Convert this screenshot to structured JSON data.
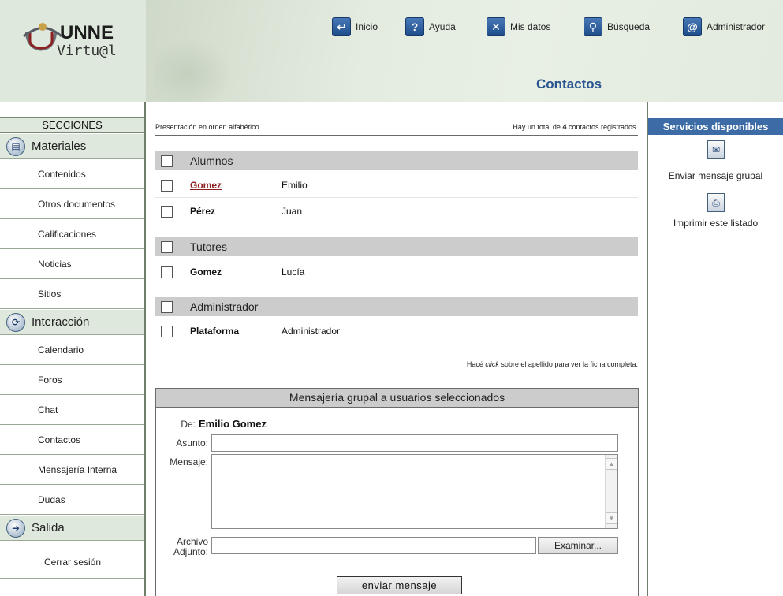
{
  "header": {
    "logo_line1": "UNNE",
    "logo_line2": "Virtu@l",
    "page_heading": "Contactos",
    "nav": [
      {
        "label": "Inicio",
        "icon": "home-icon",
        "glyph": "↩"
      },
      {
        "label": "Ayuda",
        "icon": "help-icon",
        "glyph": "?"
      },
      {
        "label": "Mis datos",
        "icon": "profile-icon",
        "glyph": "✕"
      },
      {
        "label": "Búsqueda",
        "icon": "search-icon",
        "glyph": "⚲"
      },
      {
        "label": "Administrador",
        "icon": "at-icon",
        "glyph": "@"
      }
    ]
  },
  "sidebar": {
    "title": "SECCIONES",
    "sections": [
      {
        "label": "Materiales",
        "icon": "materials-icon",
        "glyph": "▤",
        "items": [
          "Contenidos",
          "Otros documentos",
          "Calificaciones",
          "Noticias",
          "Sitios"
        ]
      },
      {
        "label": "Interacción",
        "icon": "interaction-icon",
        "glyph": "⟳",
        "items": [
          "Calendario",
          "Foros",
          "Chat",
          "Contactos",
          "Mensajería Interna",
          "Dudas"
        ]
      },
      {
        "label": "Salida",
        "icon": "exit-icon",
        "glyph": "➜",
        "items": [
          "Cerrar sesión"
        ]
      }
    ]
  },
  "main": {
    "info_left": "Presentación en orden alfabético.",
    "info_right_prefix": "Hay un total de ",
    "info_right_count": "4",
    "info_right_suffix": " contactos registrados.",
    "groups": [
      {
        "title": "Alumnos",
        "rows": [
          {
            "surname": "Gomez",
            "name": "Emilio",
            "link": true
          },
          {
            "surname": "Pérez",
            "name": "Juan",
            "link": false
          }
        ]
      },
      {
        "title": "Tutores",
        "rows": [
          {
            "surname": "Gomez",
            "name": "Lucía",
            "link": false
          }
        ]
      },
      {
        "title": "Administrador",
        "rows": [
          {
            "surname": "Plataforma",
            "name": "Administrador",
            "link": false
          }
        ]
      }
    ],
    "hint_prefix": "Hacé ",
    "hint_em": "click",
    "hint_suffix": " sobre el apellido para ver la ficha completa."
  },
  "message_panel": {
    "title": "Mensajería grupal a usuarios seleccionados",
    "from_label": "De:",
    "from_value": "Emilio Gomez",
    "subject_label": "Asunto:",
    "subject_value": "",
    "body_label": "Mensaje:",
    "body_value": "",
    "attach_label_1": "Archivo",
    "attach_label_2": "Adjunto:",
    "attach_value": "",
    "browse_label": "Examinar...",
    "send_label": "enviar mensaje"
  },
  "services": {
    "title": "Servicios disponibles",
    "items": [
      {
        "label": "Enviar mensaje grupal",
        "icon": "group-message-icon",
        "glyph": "✉"
      },
      {
        "label": "Imprimir este listado",
        "icon": "print-icon",
        "glyph": "⎙"
      }
    ]
  },
  "colors": {
    "header_bg": "#dfe8dc",
    "heading_blue": "#2a5590",
    "services_title_bg": "#3c6ba6",
    "link_red": "#8c1f1f",
    "group_header_gray": "#cccccc"
  }
}
